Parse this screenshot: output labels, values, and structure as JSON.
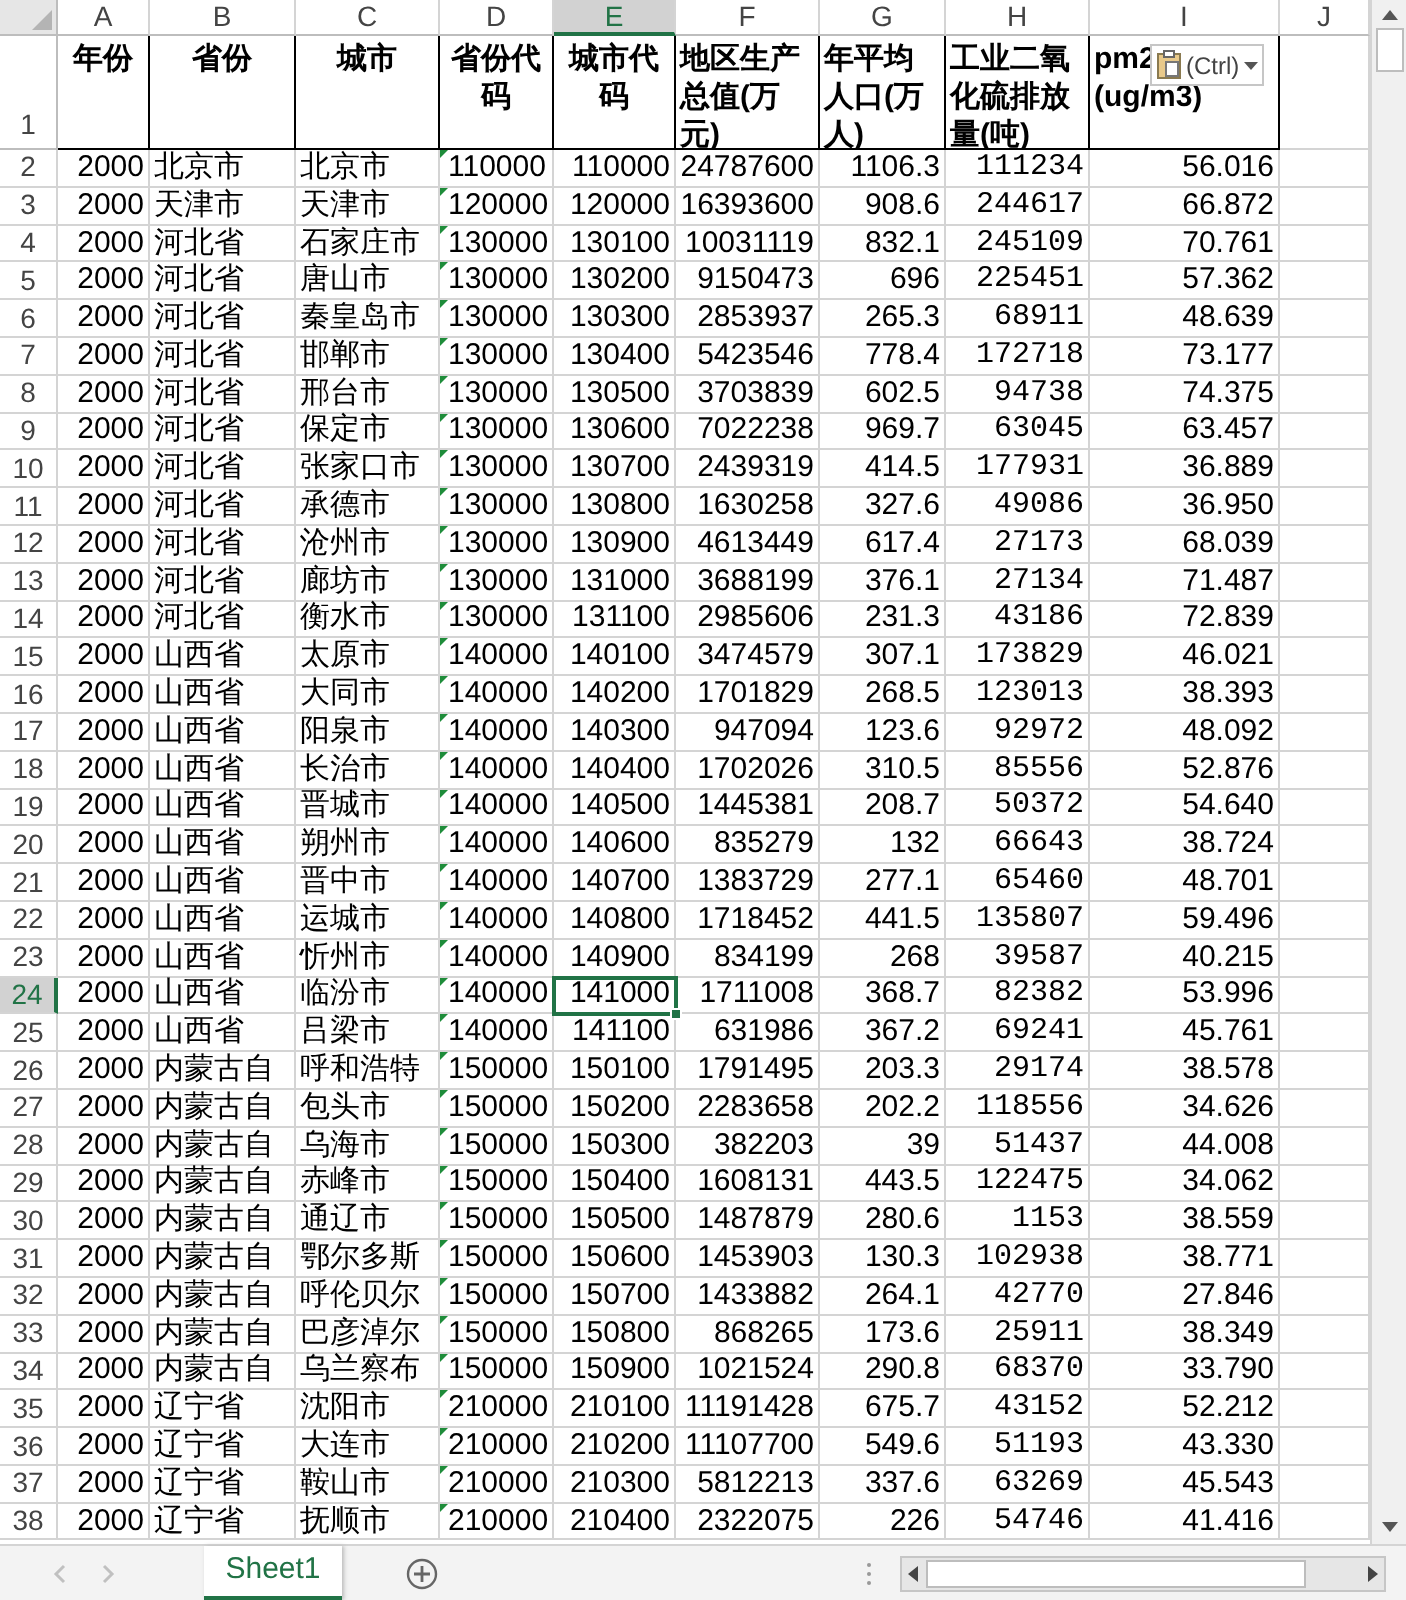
{
  "columns": [
    {
      "label": "A",
      "kind": "number",
      "selected": false
    },
    {
      "label": "B",
      "kind": "text",
      "selected": false
    },
    {
      "label": "C",
      "kind": "text",
      "selected": false
    },
    {
      "label": "D",
      "kind": "number-as-text",
      "selected": false
    },
    {
      "label": "E",
      "kind": "number",
      "selected": true
    },
    {
      "label": "F",
      "kind": "number",
      "selected": false
    },
    {
      "label": "G",
      "kind": "number",
      "selected": false
    },
    {
      "label": "H",
      "kind": "number-mono",
      "selected": false
    },
    {
      "label": "I",
      "kind": "number",
      "selected": false
    },
    {
      "label": "J",
      "kind": "empty",
      "selected": false
    }
  ],
  "header_row": {
    "number": "1",
    "cells": [
      "年份",
      "省份",
      "城市",
      "省份代码",
      "城市代码",
      "地区生产总值(万元)",
      "年平均人口(万人)",
      "工业二氧化硫排放量(吨)",
      "pm2\n(ug/m3)"
    ]
  },
  "rows": [
    {
      "number": "2",
      "selected": false,
      "cells": [
        "2000",
        "北京市",
        "北京市",
        "110000",
        "110000",
        "24787600",
        "1106.3",
        "111234",
        "56.016"
      ]
    },
    {
      "number": "3",
      "selected": false,
      "cells": [
        "2000",
        "天津市",
        "天津市",
        "120000",
        "120000",
        "16393600",
        "908.6",
        "244617",
        "66.872"
      ]
    },
    {
      "number": "4",
      "selected": false,
      "cells": [
        "2000",
        "河北省",
        "石家庄市",
        "130000",
        "130100",
        "10031119",
        "832.1",
        "245109",
        "70.761"
      ]
    },
    {
      "number": "5",
      "selected": false,
      "cells": [
        "2000",
        "河北省",
        "唐山市",
        "130000",
        "130200",
        "9150473",
        "696",
        "225451",
        "57.362"
      ]
    },
    {
      "number": "6",
      "selected": false,
      "cells": [
        "2000",
        "河北省",
        "秦皇岛市",
        "130000",
        "130300",
        "2853937",
        "265.3",
        "68911",
        "48.639"
      ]
    },
    {
      "number": "7",
      "selected": false,
      "cells": [
        "2000",
        "河北省",
        "邯郸市",
        "130000",
        "130400",
        "5423546",
        "778.4",
        "172718",
        "73.177"
      ]
    },
    {
      "number": "8",
      "selected": false,
      "cells": [
        "2000",
        "河北省",
        "邢台市",
        "130000",
        "130500",
        "3703839",
        "602.5",
        "94738",
        "74.375"
      ]
    },
    {
      "number": "9",
      "selected": false,
      "cells": [
        "2000",
        "河北省",
        "保定市",
        "130000",
        "130600",
        "7022238",
        "969.7",
        "63045",
        "63.457"
      ]
    },
    {
      "number": "10",
      "selected": false,
      "cells": [
        "2000",
        "河北省",
        "张家口市",
        "130000",
        "130700",
        "2439319",
        "414.5",
        "177931",
        "36.889"
      ]
    },
    {
      "number": "11",
      "selected": false,
      "cells": [
        "2000",
        "河北省",
        "承德市",
        "130000",
        "130800",
        "1630258",
        "327.6",
        "49086",
        "36.950"
      ]
    },
    {
      "number": "12",
      "selected": false,
      "cells": [
        "2000",
        "河北省",
        "沧州市",
        "130000",
        "130900",
        "4613449",
        "617.4",
        "27173",
        "68.039"
      ]
    },
    {
      "number": "13",
      "selected": false,
      "cells": [
        "2000",
        "河北省",
        "廊坊市",
        "130000",
        "131000",
        "3688199",
        "376.1",
        "27134",
        "71.487"
      ]
    },
    {
      "number": "14",
      "selected": false,
      "cells": [
        "2000",
        "河北省",
        "衡水市",
        "130000",
        "131100",
        "2985606",
        "231.3",
        "43186",
        "72.839"
      ]
    },
    {
      "number": "15",
      "selected": false,
      "cells": [
        "2000",
        "山西省",
        "太原市",
        "140000",
        "140100",
        "3474579",
        "307.1",
        "173829",
        "46.021"
      ]
    },
    {
      "number": "16",
      "selected": false,
      "cells": [
        "2000",
        "山西省",
        "大同市",
        "140000",
        "140200",
        "1701829",
        "268.5",
        "123013",
        "38.393"
      ]
    },
    {
      "number": "17",
      "selected": false,
      "cells": [
        "2000",
        "山西省",
        "阳泉市",
        "140000",
        "140300",
        "947094",
        "123.6",
        "92972",
        "48.092"
      ]
    },
    {
      "number": "18",
      "selected": false,
      "cells": [
        "2000",
        "山西省",
        "长治市",
        "140000",
        "140400",
        "1702026",
        "310.5",
        "85556",
        "52.876"
      ]
    },
    {
      "number": "19",
      "selected": false,
      "cells": [
        "2000",
        "山西省",
        "晋城市",
        "140000",
        "140500",
        "1445381",
        "208.7",
        "50372",
        "54.640"
      ]
    },
    {
      "number": "20",
      "selected": false,
      "cells": [
        "2000",
        "山西省",
        "朔州市",
        "140000",
        "140600",
        "835279",
        "132",
        "66643",
        "38.724"
      ]
    },
    {
      "number": "21",
      "selected": false,
      "cells": [
        "2000",
        "山西省",
        "晋中市",
        "140000",
        "140700",
        "1383729",
        "277.1",
        "65460",
        "48.701"
      ]
    },
    {
      "number": "22",
      "selected": false,
      "cells": [
        "2000",
        "山西省",
        "运城市",
        "140000",
        "140800",
        "1718452",
        "441.5",
        "135807",
        "59.496"
      ]
    },
    {
      "number": "23",
      "selected": false,
      "cells": [
        "2000",
        "山西省",
        "忻州市",
        "140000",
        "140900",
        "834199",
        "268",
        "39587",
        "40.215"
      ]
    },
    {
      "number": "24",
      "selected": true,
      "cells": [
        "2000",
        "山西省",
        "临汾市",
        "140000",
        "141000",
        "1711008",
        "368.7",
        "82382",
        "53.996"
      ]
    },
    {
      "number": "25",
      "selected": false,
      "cells": [
        "2000",
        "山西省",
        "吕梁市",
        "140000",
        "141100",
        "631986",
        "367.2",
        "69241",
        "45.761"
      ]
    },
    {
      "number": "26",
      "selected": false,
      "cells": [
        "2000",
        "内蒙古自",
        "呼和浩特",
        "150000",
        "150100",
        "1791495",
        "203.3",
        "29174",
        "38.578"
      ]
    },
    {
      "number": "27",
      "selected": false,
      "cells": [
        "2000",
        "内蒙古自",
        "包头市",
        "150000",
        "150200",
        "2283658",
        "202.2",
        "118556",
        "34.626"
      ]
    },
    {
      "number": "28",
      "selected": false,
      "cells": [
        "2000",
        "内蒙古自",
        "乌海市",
        "150000",
        "150300",
        "382203",
        "39",
        "51437",
        "44.008"
      ]
    },
    {
      "number": "29",
      "selected": false,
      "cells": [
        "2000",
        "内蒙古自",
        "赤峰市",
        "150000",
        "150400",
        "1608131",
        "443.5",
        "122475",
        "34.062"
      ]
    },
    {
      "number": "30",
      "selected": false,
      "cells": [
        "2000",
        "内蒙古自",
        "通辽市",
        "150000",
        "150500",
        "1487879",
        "280.6",
        "1153",
        "38.559"
      ]
    },
    {
      "number": "31",
      "selected": false,
      "cells": [
        "2000",
        "内蒙古自",
        "鄂尔多斯",
        "150000",
        "150600",
        "1453903",
        "130.3",
        "102938",
        "38.771"
      ]
    },
    {
      "number": "32",
      "selected": false,
      "cells": [
        "2000",
        "内蒙古自",
        "呼伦贝尔",
        "150000",
        "150700",
        "1433882",
        "264.1",
        "42770",
        "27.846"
      ]
    },
    {
      "number": "33",
      "selected": false,
      "cells": [
        "2000",
        "内蒙古自",
        "巴彦淖尔",
        "150000",
        "150800",
        "868265",
        "173.6",
        "25911",
        "38.349"
      ]
    },
    {
      "number": "34",
      "selected": false,
      "cells": [
        "2000",
        "内蒙古自",
        "乌兰察布",
        "150000",
        "150900",
        "1021524",
        "290.8",
        "68370",
        "33.790"
      ]
    },
    {
      "number": "35",
      "selected": false,
      "cells": [
        "2000",
        "辽宁省",
        "沈阳市",
        "210000",
        "210100",
        "11191428",
        "675.7",
        "43152",
        "52.212"
      ]
    },
    {
      "number": "36",
      "selected": false,
      "cells": [
        "2000",
        "辽宁省",
        "大连市",
        "210000",
        "210200",
        "11107700",
        "549.6",
        "51193",
        "43.330"
      ]
    },
    {
      "number": "37",
      "selected": false,
      "cells": [
        "2000",
        "辽宁省",
        "鞍山市",
        "210000",
        "210300",
        "5812213",
        "337.6",
        "63269",
        "45.543"
      ]
    },
    {
      "number": "38",
      "selected": false,
      "cells": [
        "2000",
        "辽宁省",
        "抚顺市",
        "210000",
        "210400",
        "2322075",
        "226",
        "54746",
        "41.416"
      ]
    }
  ],
  "paste_options": {
    "label": "(Ctrl)"
  },
  "sheet_tabs": [
    {
      "label": "Sheet1",
      "selected": true
    }
  ]
}
